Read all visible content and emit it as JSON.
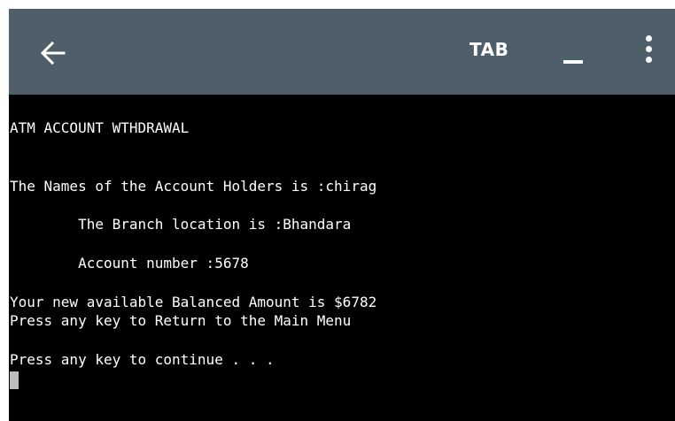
{
  "toolbar": {
    "back_icon": "arrow-left-icon",
    "tab_label": "TAB",
    "hide_keyboard_label": "_",
    "menu_icon": "more-vert-icon",
    "background": "#4f5f69"
  },
  "terminal": {
    "background": "#000000",
    "text_color": "#ffffff",
    "lines": [
      "ATM ACCOUNT WTHDRAWAL",
      "The Names of the Account Holders is :chirag",
      "        The Branch location is :Bhandara",
      "        Account number :5678",
      "Your new available Balanced Amount is $6782",
      "Press any key to Return to the Main Menu",
      "Press any key to continue . . ."
    ]
  }
}
